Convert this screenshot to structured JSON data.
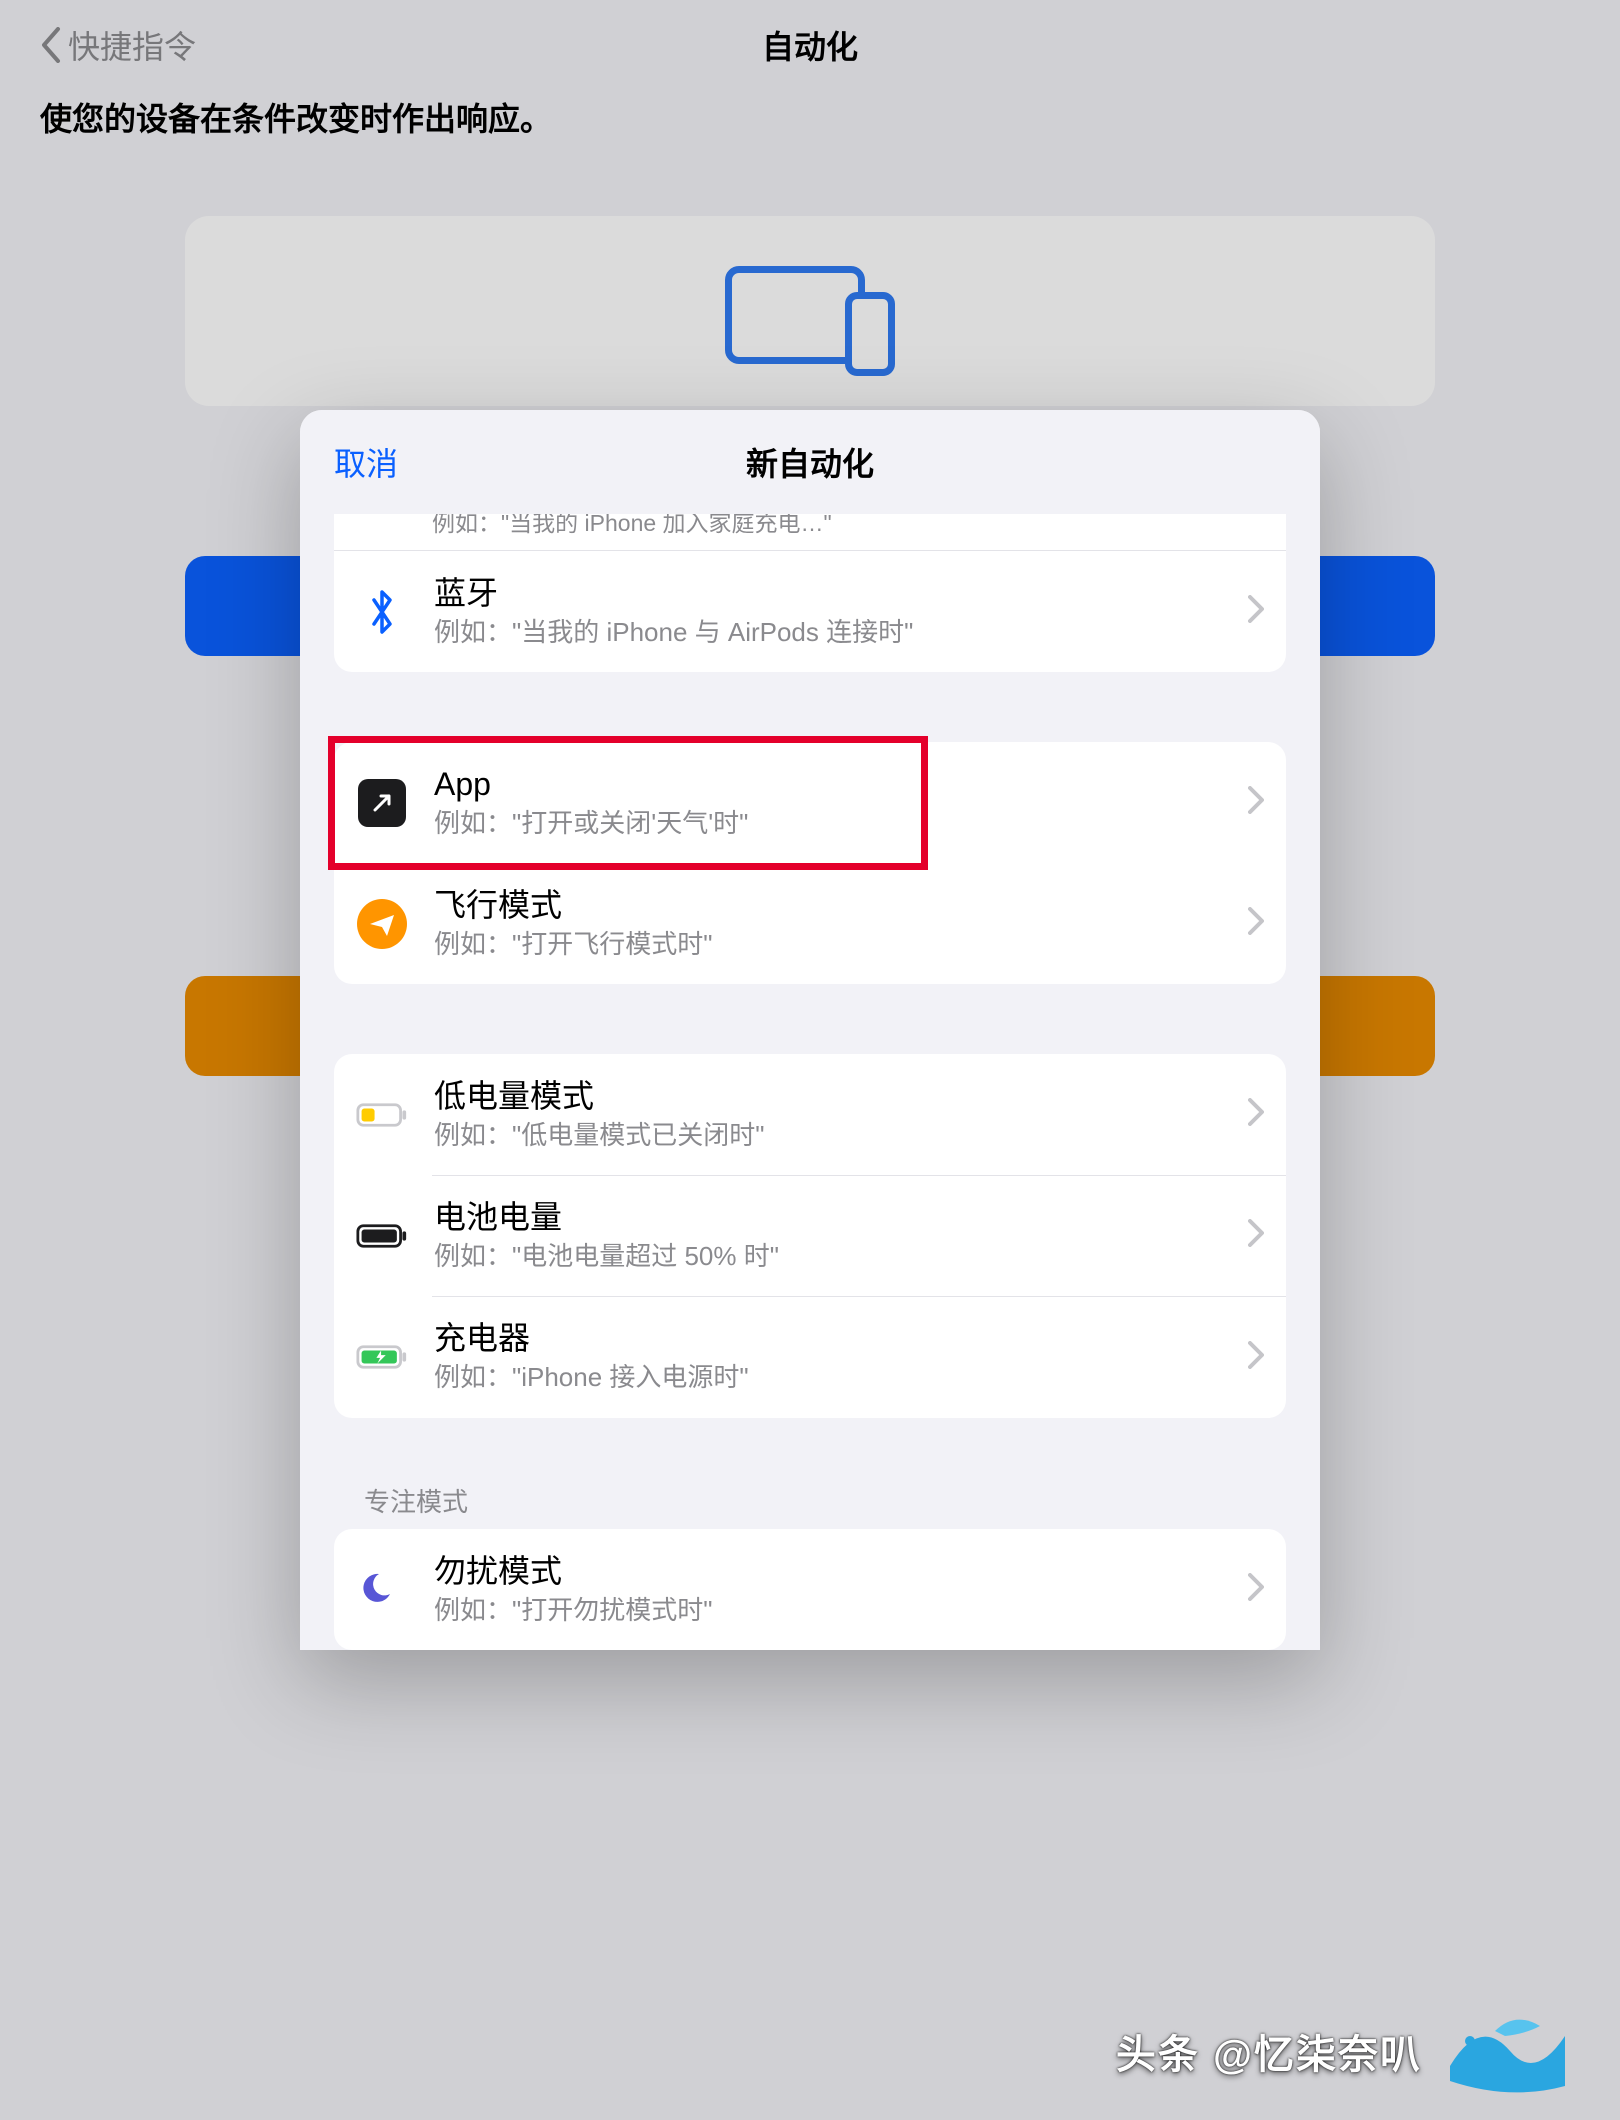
{
  "nav": {
    "back_label": "快捷指令",
    "title": "自动化",
    "subtitle": "使您的设备在条件改变时作出响应。"
  },
  "sheet": {
    "cancel": "取消",
    "title": "新自动化",
    "truncated_line": "例如：\"当我的 iPhone 加入家庭充电…\"",
    "section_focus_label": "专注模式",
    "groups": [
      {
        "rows": [
          {
            "icon": "bluetooth-icon",
            "title": "蓝牙",
            "subtitle": "例如：\"当我的 iPhone 与 AirPods 连接时\""
          }
        ]
      },
      {
        "rows": [
          {
            "icon": "app-icon",
            "title": "App",
            "subtitle": "例如：\"打开或关闭'天气'时\"",
            "highlight": true
          },
          {
            "icon": "airplane-icon",
            "title": "飞行模式",
            "subtitle": "例如：\"打开飞行模式时\""
          }
        ]
      },
      {
        "rows": [
          {
            "icon": "low-power-icon",
            "title": "低电量模式",
            "subtitle": "例如：\"低电量模式已关闭时\""
          },
          {
            "icon": "battery-level-icon",
            "title": "电池电量",
            "subtitle": "例如：\"电池电量超过 50% 时\""
          },
          {
            "icon": "charger-icon",
            "title": "充电器",
            "subtitle": "例如：\"iPhone 接入电源时\""
          }
        ]
      },
      {
        "label_key": "section_focus_label",
        "rows": [
          {
            "icon": "moon-icon",
            "title": "勿扰模式",
            "subtitle": "例如：\"打开勿扰模式时\""
          }
        ]
      }
    ]
  },
  "footer": {
    "text": "头条 @忆柒奈叭",
    "logo_label": "watermark-logo"
  },
  "colors": {
    "accent": "#0a60ff",
    "orange": "#ff9500",
    "highlight": "#e4002b",
    "green": "#34c759",
    "purple": "#5856d6"
  }
}
